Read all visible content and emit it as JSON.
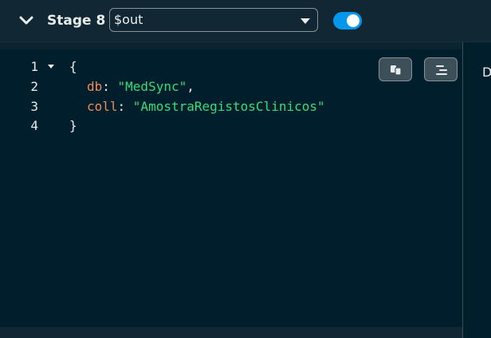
{
  "stage": {
    "label": "Stage 8",
    "operator": "$out",
    "enabled": true
  },
  "editor": {
    "lines": [
      {
        "number": "1",
        "brace": "{"
      },
      {
        "number": "2",
        "key": "db",
        "value": "\"MedSync\"",
        "trail": ","
      },
      {
        "number": "3",
        "key": "coll",
        "value": "\"AmostraRegistosClinicos\""
      },
      {
        "number": "4",
        "brace": "}"
      }
    ],
    "buttons": {
      "copy_icon": "copy-icon",
      "format_icon": "format-icon"
    }
  },
  "preview": {
    "text": "D"
  },
  "colors": {
    "background": "#001e2b",
    "header": "#112733",
    "key": "#ef8a5c",
    "string": "#35de7b",
    "toggle": "#0498ec"
  }
}
